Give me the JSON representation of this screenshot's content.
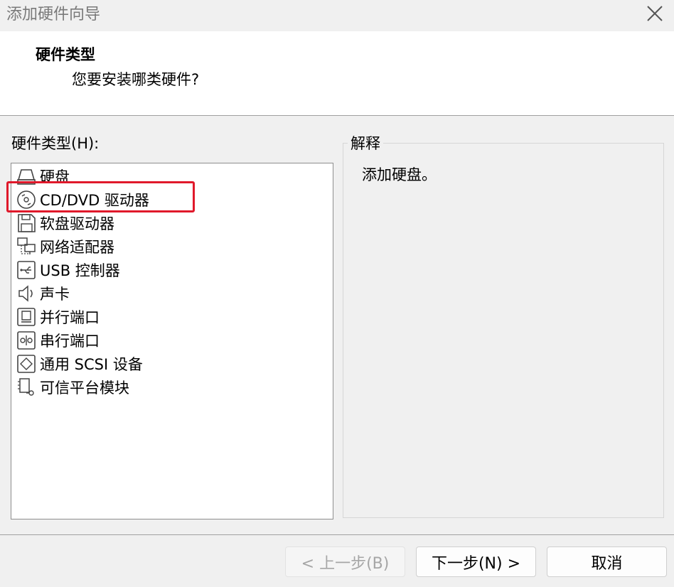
{
  "window": {
    "title": "添加硬件向导"
  },
  "header": {
    "title": "硬件类型",
    "subtitle": "您要安装哪类硬件?"
  },
  "list": {
    "label": "硬件类型(H):",
    "items": [
      {
        "label": "硬盘",
        "icon": "hard-disk-icon"
      },
      {
        "label": "CD/DVD 驱动器",
        "icon": "cd-dvd-icon"
      },
      {
        "label": "软盘驱动器",
        "icon": "floppy-icon"
      },
      {
        "label": "网络适配器",
        "icon": "network-adapter-icon"
      },
      {
        "label": "USB 控制器",
        "icon": "usb-icon"
      },
      {
        "label": "声卡",
        "icon": "speaker-icon"
      },
      {
        "label": "并行端口",
        "icon": "parallel-port-icon"
      },
      {
        "label": "串行端口",
        "icon": "serial-port-icon"
      },
      {
        "label": "通用 SCSI 设备",
        "icon": "scsi-icon"
      },
      {
        "label": "可信平台模块",
        "icon": "tpm-icon"
      }
    ]
  },
  "explanation": {
    "legend": "解释",
    "text": "添加硬盘。"
  },
  "buttons": {
    "back": "< 上一步(B)",
    "next": "下一步(N) >",
    "cancel": "取消"
  },
  "colors": {
    "highlight": "#e0192b"
  }
}
